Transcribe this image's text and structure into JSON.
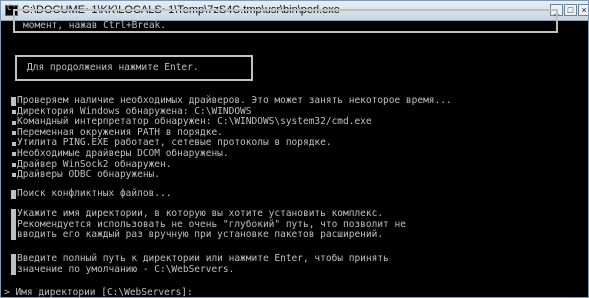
{
  "window": {
    "title": "C:\\DOCUME~1\\KK\\LOCALS~1\\Temp\\7zS4C.tmp\\usr\\bin\\perl.exe"
  },
  "console": {
    "top_box_line": "момент, нажав Ctrl+Break.",
    "enter_prompt": "Для продолжения нажмите Enter.",
    "check_lines": [
      "Проверяем наличие необходимых драйверов. Это может занять некоторое время...",
      "Директория Windows обнаружена: C:\\WINDOWS",
      "Командный интерпретатор обнаружен: C:\\WINDOWS\\system32/cmd.exe",
      "Переменная окружения PATH в порядке.",
      "Утилита PING.EXE работает, сетевые протоколы в порядке.",
      "Необходимые драйверы DCOM обнаружены.",
      "Драйвер WinSock2 обнаружен.",
      "Драйверы ODBC обнаружены."
    ],
    "conflict_line": "Поиск конфликтных файлов...",
    "dir_lines": [
      "Укажите имя директории, в которую вы хотите установить комплекс.",
      "Рекомендуется использовать не очень \"глубокий\" путь, что позволит не",
      "вводить его каждый раз вручную при установке пакетов расширений."
    ],
    "path_lines": [
      "Введите полный путь к директории или нажмите Enter, чтобы принять",
      "значение по умолчанию - C:\\WebServers."
    ],
    "input_prompt": "> Имя директории [C:\\WebServers]:"
  }
}
